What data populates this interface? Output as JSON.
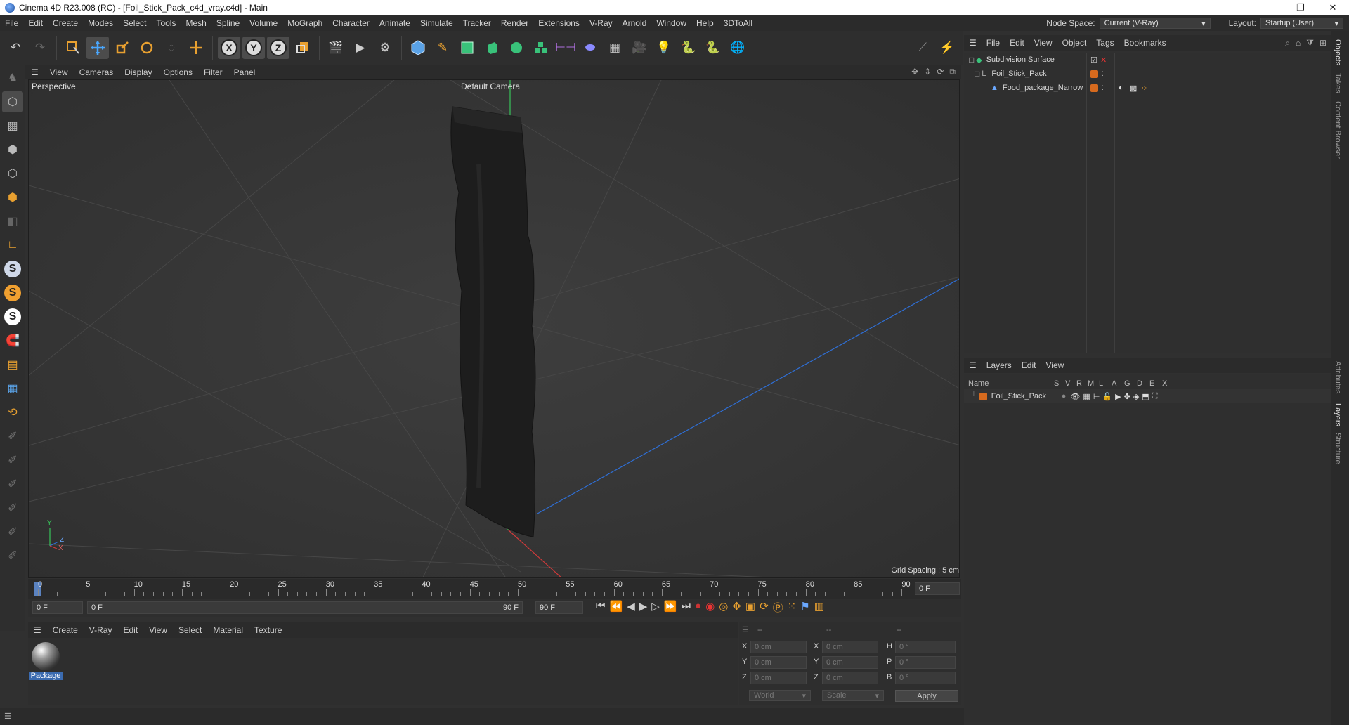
{
  "window": {
    "title": "Cinema 4D R23.008 (RC) - [Foil_Stick_Pack_c4d_vray.c4d] - Main",
    "min": "—",
    "max": "❐",
    "close": "✕"
  },
  "menu": [
    "File",
    "Edit",
    "Create",
    "Modes",
    "Select",
    "Tools",
    "Mesh",
    "Spline",
    "Volume",
    "MoGraph",
    "Character",
    "Animate",
    "Simulate",
    "Tracker",
    "Render",
    "Extensions",
    "V-Ray",
    "Arnold",
    "Window",
    "Help",
    "3DToAll"
  ],
  "node_space": {
    "label": "Node Space:",
    "value": "Current (V-Ray)"
  },
  "layout": {
    "label": "Layout:",
    "value": "Startup (User)"
  },
  "viewport": {
    "menu": [
      "View",
      "Cameras",
      "Display",
      "Options",
      "Filter",
      "Panel"
    ],
    "projection": "Perspective",
    "camera": "Default Camera",
    "grid_spacing": "Grid Spacing : 5 cm",
    "axes": {
      "y": "Y",
      "z": "Z",
      "x": "X"
    }
  },
  "timeline": {
    "ticks": [
      "0",
      "5",
      "10",
      "15",
      "20",
      "25",
      "30",
      "35",
      "40",
      "45",
      "50",
      "55",
      "60",
      "65",
      "70",
      "75",
      "80",
      "85",
      "90"
    ],
    "current_frame_right": "0 F",
    "start_field": "0 F",
    "range_start": "0 F",
    "range_end": "90 F",
    "end_field": "90 F"
  },
  "material_panel": {
    "menu": [
      "Create",
      "V-Ray",
      "Edit",
      "View",
      "Select",
      "Material",
      "Texture"
    ],
    "materials": [
      {
        "name": "Package"
      }
    ]
  },
  "coords": {
    "headers": [
      "--",
      "--",
      "--"
    ],
    "rows": [
      {
        "a": "X",
        "av": "0 cm",
        "b": "X",
        "bv": "0 cm",
        "c": "H",
        "cv": "0 °"
      },
      {
        "a": "Y",
        "av": "0 cm",
        "b": "Y",
        "bv": "0 cm",
        "c": "P",
        "cv": "0 °"
      },
      {
        "a": "Z",
        "av": "0 cm",
        "b": "Z",
        "bv": "0 cm",
        "c": "B",
        "cv": "0 °"
      }
    ],
    "space": "World",
    "mode": "Scale",
    "apply": "Apply"
  },
  "objects_panel": {
    "menu": [
      "File",
      "Edit",
      "View",
      "Object",
      "Tags",
      "Bookmarks"
    ],
    "items": [
      {
        "name": "Subdivision Surface"
      },
      {
        "name": "Foil_Stick_Pack"
      },
      {
        "name": "Food_package_Narrow"
      }
    ]
  },
  "layers_panel": {
    "menu": [
      "Layers",
      "Edit",
      "View"
    ],
    "columns": [
      "Name",
      "S",
      "V",
      "R",
      "M",
      "L",
      "A",
      "G",
      "D",
      "E",
      "X"
    ],
    "items": [
      {
        "name": "Foil_Stick_Pack"
      }
    ]
  },
  "right_tabs": [
    "Objects",
    "Takes",
    "Content Browser",
    "Attributes",
    "Layers",
    "Structure"
  ],
  "colors": {
    "accent_orange": "#d66a1e",
    "axis_green": "#37c45a",
    "axis_blue": "#2f6fd6",
    "axis_red": "#d23a3a"
  }
}
